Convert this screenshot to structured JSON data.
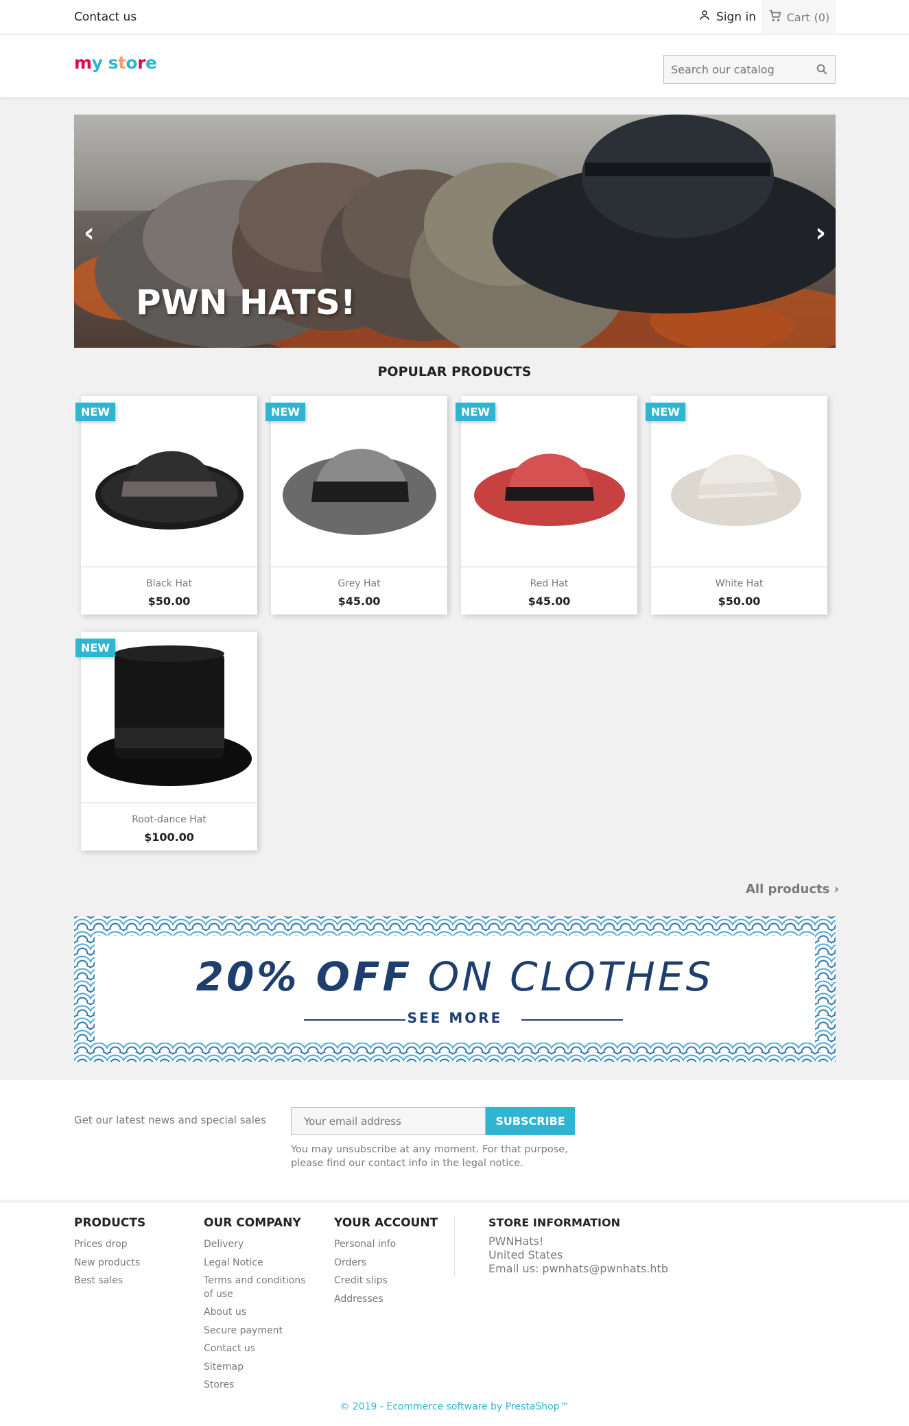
{
  "topbar": {
    "contact_label": "Contact us",
    "signin_label": "Sign in",
    "cart_label": "Cart",
    "cart_count": "(0)"
  },
  "header": {
    "logo_text": "my store",
    "search_placeholder": "Search our catalog"
  },
  "slider": {
    "caption": "PWN HATS!"
  },
  "popular": {
    "title": "POPULAR PRODUCTS",
    "badge": "NEW",
    "products": [
      {
        "name": "Black Hat",
        "price": "$50.00",
        "color": "#2a2a2a"
      },
      {
        "name": "Grey Hat",
        "price": "$45.00",
        "color": "#7a7a7a"
      },
      {
        "name": "Red Hat",
        "price": "$45.00",
        "color": "#d14b4b"
      },
      {
        "name": "White Hat",
        "price": "$50.00",
        "color": "#e9e6df"
      },
      {
        "name": "Root-dance Hat",
        "price": "$100.00",
        "color": "#151515"
      }
    ],
    "all_products_label": "All products"
  },
  "banner": {
    "headline_bold": "20% OFF",
    "headline_rest": "ON CLOTHES",
    "cta": "SEE MORE"
  },
  "newsletter": {
    "label": "Get our latest news and special sales",
    "email_placeholder": "Your email address",
    "subscribe_label": "SUBSCRIBE",
    "note": "You may unsubscribe at any moment. For that purpose, please find our contact info in the legal notice."
  },
  "footer": {
    "products": {
      "title": "PRODUCTS",
      "items": [
        "Prices drop",
        "New products",
        "Best sales"
      ]
    },
    "company": {
      "title": "OUR COMPANY",
      "items": [
        "Delivery",
        "Legal Notice",
        "Terms and conditions of use",
        "About us",
        "Secure payment",
        "Contact us",
        "Sitemap",
        "Stores"
      ]
    },
    "account": {
      "title": "YOUR ACCOUNT",
      "items": [
        "Personal info",
        "Orders",
        "Credit slips",
        "Addresses"
      ]
    },
    "store": {
      "title": "STORE INFORMATION",
      "name": "PWNHats!",
      "country": "United States",
      "email": "Email us: pwnhats@pwnhats.htb"
    },
    "copyright": "© 2019 - Ecommerce software by PrestaShop™"
  },
  "colors": {
    "accent": "#2fb5d2",
    "banner_blue": "#1e3f6e"
  }
}
